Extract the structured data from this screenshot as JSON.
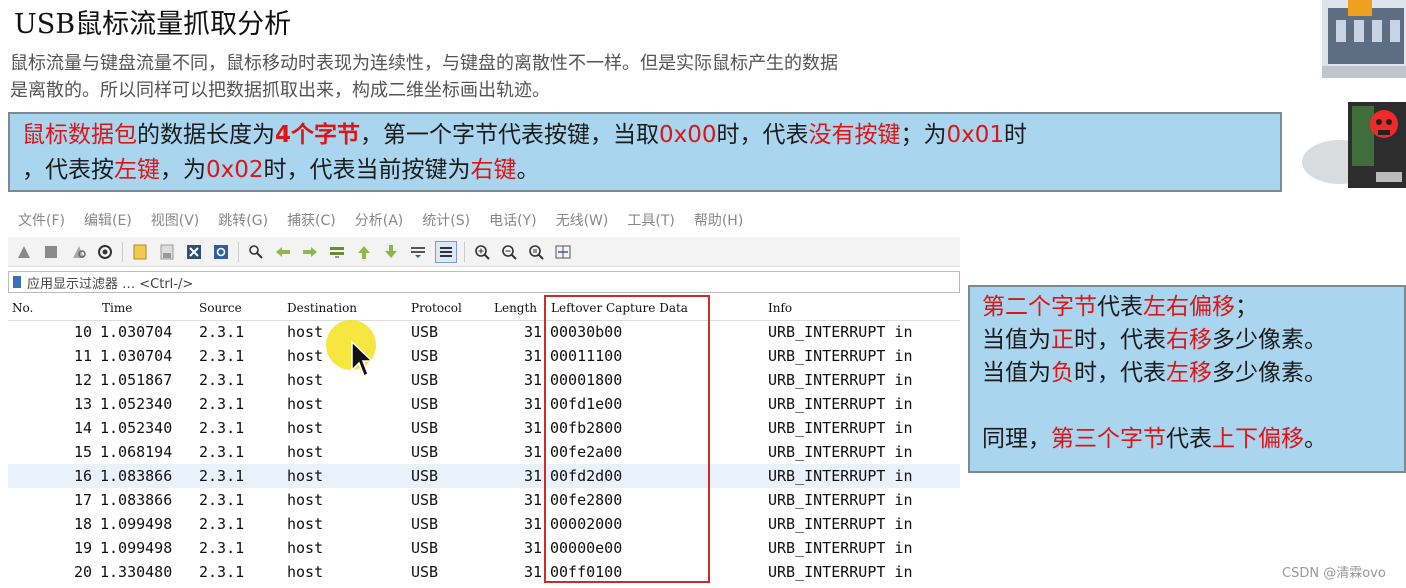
{
  "title": "USB鼠标流量抓取分析",
  "intro": {
    "line1": "鼠标流量与键盘流量不同，鼠标移动时表现为连续性，与键盘的离散性不一样。但是实际鼠标产生的数据",
    "line2": "是离散的。所以同样可以把数据抓取出来，构成二维坐标画出轨迹。"
  },
  "note1": {
    "p1": "鼠标数据包",
    "p2": "的数据长度为",
    "p3": "4个字节",
    "p4": "，第一个字节代表按键，当取",
    "p5": "0x00",
    "p6": "时，代表",
    "p7": "没有按键",
    "p8": "；为",
    "p9": "0x01",
    "p10": "时",
    "p11": "，代表按",
    "p12": "左键",
    "p13": "，为",
    "p14": "0x02",
    "p15": "时，代表当前按键为",
    "p16": "右键",
    "p17": "。"
  },
  "menu": [
    "文件(F)",
    "编辑(E)",
    "视图(V)",
    "跳转(G)",
    "捕获(C)",
    "分析(A)",
    "统计(S)",
    "电话(Y)",
    "无线(W)",
    "工具(T)",
    "帮助(H)"
  ],
  "filter": {
    "label": "应用显示过滤器 … <Ctrl-/>"
  },
  "columns": {
    "no": "No.",
    "time": "Time",
    "source": "Source",
    "destination": "Destination",
    "protocol": "Protocol",
    "length": "Length",
    "data": "Leftover Capture Data",
    "info": "Info"
  },
  "packets": [
    {
      "no": "10",
      "time": "1.030704",
      "src": "2.3.1",
      "dst": "host",
      "proto": "USB",
      "len": "31",
      "data": "00030b00",
      "info": "URB_INTERRUPT in"
    },
    {
      "no": "11",
      "time": "1.030704",
      "src": "2.3.1",
      "dst": "host",
      "proto": "USB",
      "len": "31",
      "data": "00011100",
      "info": "URB_INTERRUPT in"
    },
    {
      "no": "12",
      "time": "1.051867",
      "src": "2.3.1",
      "dst": "host",
      "proto": "USB",
      "len": "31",
      "data": "00001800",
      "info": "URB_INTERRUPT in"
    },
    {
      "no": "13",
      "time": "1.052340",
      "src": "2.3.1",
      "dst": "host",
      "proto": "USB",
      "len": "31",
      "data": "00fd1e00",
      "info": "URB_INTERRUPT in"
    },
    {
      "no": "14",
      "time": "1.052340",
      "src": "2.3.1",
      "dst": "host",
      "proto": "USB",
      "len": "31",
      "data": "00fb2800",
      "info": "URB_INTERRUPT in"
    },
    {
      "no": "15",
      "time": "1.068194",
      "src": "2.3.1",
      "dst": "host",
      "proto": "USB",
      "len": "31",
      "data": "00fe2a00",
      "info": "URB_INTERRUPT in"
    },
    {
      "no": "16",
      "time": "1.083866",
      "src": "2.3.1",
      "dst": "host",
      "proto": "USB",
      "len": "31",
      "data": "00fd2d00",
      "info": "URB_INTERRUPT in"
    },
    {
      "no": "17",
      "time": "1.083866",
      "src": "2.3.1",
      "dst": "host",
      "proto": "USB",
      "len": "31",
      "data": "00fe2800",
      "info": "URB_INTERRUPT in"
    },
    {
      "no": "18",
      "time": "1.099498",
      "src": "2.3.1",
      "dst": "host",
      "proto": "USB",
      "len": "31",
      "data": "00002000",
      "info": "URB_INTERRUPT in"
    },
    {
      "no": "19",
      "time": "1.099498",
      "src": "2.3.1",
      "dst": "host",
      "proto": "USB",
      "len": "31",
      "data": "00000e00",
      "info": "URB_INTERRUPT in"
    },
    {
      "no": "20",
      "time": "1.330480",
      "src": "2.3.1",
      "dst": "host",
      "proto": "USB",
      "len": "31",
      "data": "00ff0100",
      "info": "URB_INTERRUPT in"
    }
  ],
  "selected_packet": "16",
  "note2": {
    "l1a": "第二个字节",
    "l1b": "代表",
    "l1c": "左右偏移",
    "l1d": "；",
    "l2a": "当值为",
    "l2b": "正",
    "l2c": "时，代表",
    "l2d": "右移",
    "l2e": "多少像素。",
    "l3a": "当值为",
    "l3b": "负",
    "l3c": "时，代表",
    "l3d": "左移",
    "l3e": "多少像素。",
    "l4a": "同理，",
    "l4b": "第三个字节",
    "l4c": "代表",
    "l4d": "上下偏移",
    "l4e": "。"
  },
  "watermark": "CSDN @清霖ovo",
  "colors": {
    "note_bg": "#a9d5ee",
    "highlight_red": "#e01414",
    "frame_red": "#d02a2a",
    "selected_row": "#e9f1fb",
    "cursor_highlight": "#f3e21f"
  }
}
